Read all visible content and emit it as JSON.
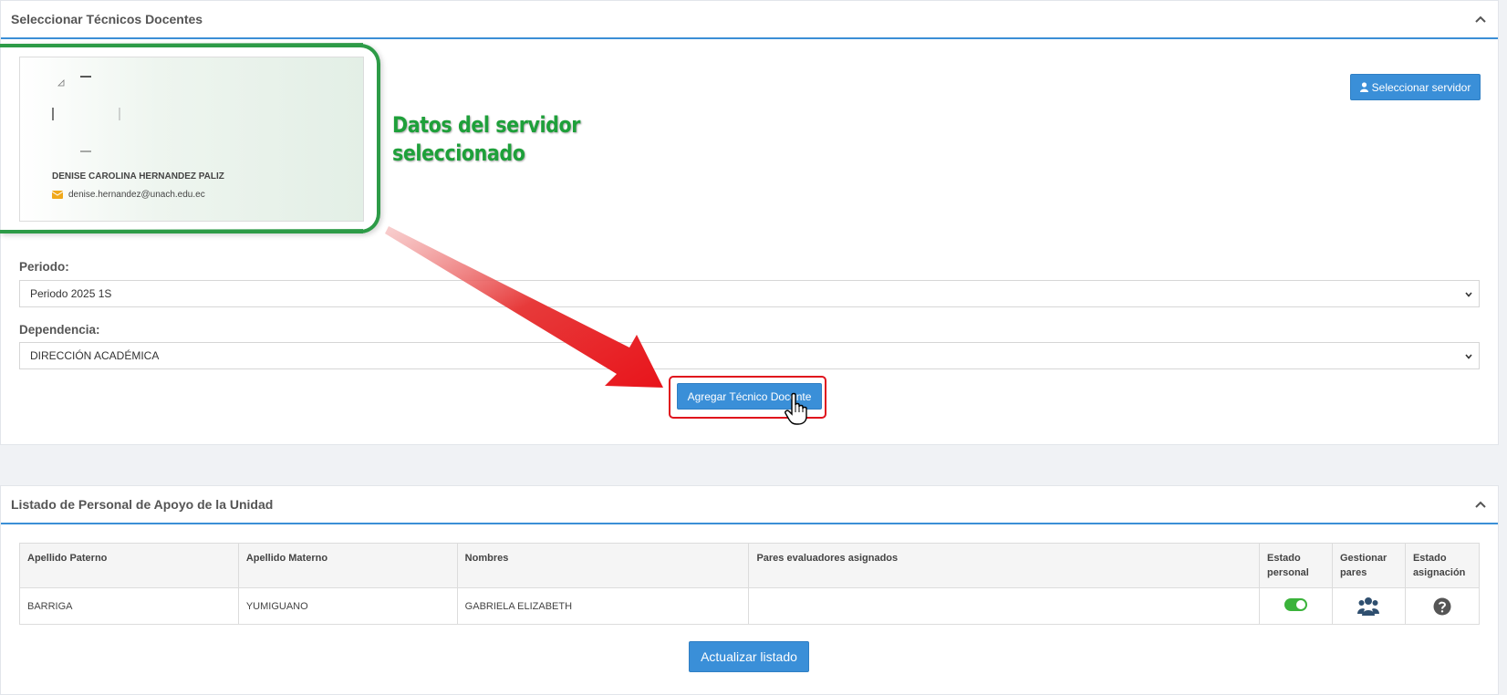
{
  "top_panel": {
    "title": "Seleccionar Técnicos Docentes",
    "select_server_button": "Seleccionar servidor",
    "selected_server": {
      "name": "DENISE CAROLINA HERNANDEZ PALIZ",
      "email": "denise.hernandez@unach.edu.ec"
    },
    "annotation": {
      "line1": "Datos del servidor",
      "line2": "seleccionado"
    },
    "periodo": {
      "label": "Periodo:",
      "value": "Periodo 2025 1S"
    },
    "dependencia": {
      "label": "Dependencia:",
      "value": "DIRECCIÓN ACADÉMICA"
    },
    "add_button": "Agregar Técnico Docente"
  },
  "bottom_panel": {
    "title": "Listado de Personal de Apoyo de la Unidad",
    "table": {
      "headers": {
        "apellido_paterno": "Apellido Paterno",
        "apellido_materno": "Apellido Materno",
        "nombres": "Nombres",
        "pares": "Pares evaluadores asignados",
        "estado_personal_1": "Estado",
        "estado_personal_2": "personal",
        "gestionar_1": "Gestionar",
        "gestionar_2": "pares",
        "estado_asig_1": "Estado",
        "estado_asig_2": "asignación"
      },
      "rows": [
        {
          "apellido_paterno": "BARRIGA",
          "apellido_materno": "YUMIGUANO",
          "nombres": "GABRIELA ELIZABETH",
          "pares": "",
          "estado_personal": true
        }
      ]
    },
    "refresh_button": "Actualizar listado"
  },
  "colors": {
    "primary": "#3a8fd8",
    "annotation_green": "#1ea03a",
    "highlight_red": "#e0121d",
    "toggle_on": "#3bb33b"
  },
  "icons": [
    "chevron-up-icon",
    "user-icon",
    "envelope-icon",
    "chevron-down-icon",
    "users-icon",
    "question-circle-icon",
    "hand-pointer-icon",
    "red-arrow"
  ]
}
